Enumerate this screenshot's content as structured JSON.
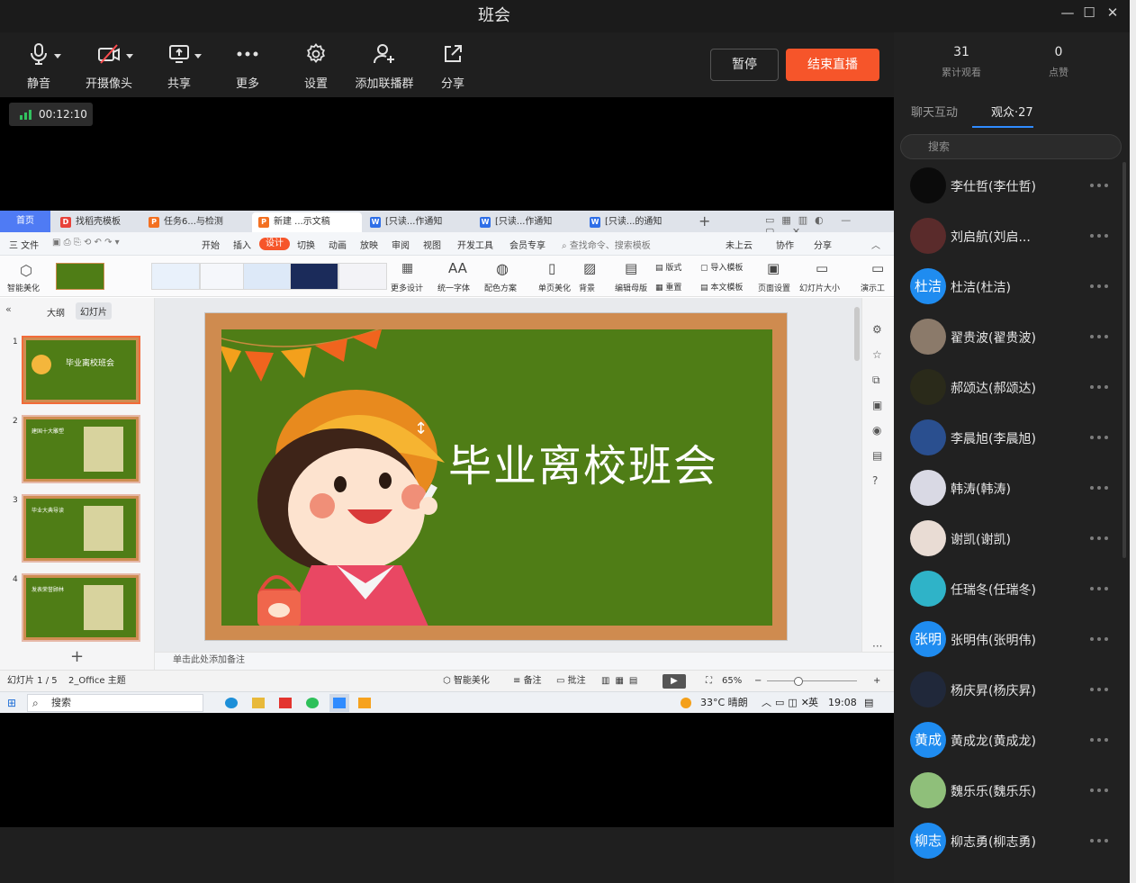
{
  "window": {
    "title": "班会"
  },
  "toolbar": {
    "mute_label": "静音",
    "camera_label": "开摄像头",
    "share_label": "共享",
    "more_label": "更多",
    "settings_label": "设置",
    "add_cohost_label": "添加联播群",
    "forward_label": "分享",
    "pause_label": "暂停",
    "end_label": "结束直播"
  },
  "live": {
    "elapsed": "00:12:10"
  },
  "wps": {
    "home_tab": "首页",
    "tabs": [
      "找稻壳模板",
      "任务6...与检测",
      "新建 ...示文稿",
      "[只读...作通知",
      "[只读...作通知",
      "[只读...的通知"
    ],
    "menu": [
      "三 文件",
      "开始",
      "插入",
      "设计",
      "切换",
      "动画",
      "放映",
      "审阅",
      "视图",
      "开发工具",
      "会员专享"
    ],
    "menu_search": "查找命令、搜索模板",
    "menu_right": [
      "未上云",
      "协作",
      "分享"
    ],
    "ribbon": {
      "smart_beautify": "智能美化",
      "more_design": "更多设计",
      "unify_fonts": "统一字体",
      "color_scheme": "配色方案",
      "single_page_beautify": "单页美化",
      "background": "背景",
      "edit_master": "编辑母版",
      "layout": "版式",
      "rearrange": "重置",
      "import_template": "导入模板",
      "text_template": "本文模板",
      "page_setup": "页面设置",
      "slide_size": "幻灯片大小",
      "present": "演示工"
    },
    "panel_tabs": [
      "大纲",
      "幻灯片"
    ],
    "slide_thumbs": [
      {
        "num": "1",
        "title": "毕业离校班会"
      },
      {
        "num": "2",
        "title": "建国十大雕塑"
      },
      {
        "num": "3",
        "title": "毕业大典导读"
      },
      {
        "num": "4",
        "title": "发表荣誉顾林"
      }
    ],
    "slide_title": "毕业离校班会",
    "notes_placeholder": "单击此处添加备注",
    "status": {
      "slide_counter": "幻灯片 1 / 5",
      "theme": "2_Office 主题",
      "smart_beautify": "智能美化",
      "notes": "备注",
      "comments": "批注",
      "zoom": "65%"
    }
  },
  "taskbar": {
    "search_placeholder": "搜索",
    "weather": "33°C  晴朗",
    "ime": "英",
    "time": "19:08"
  },
  "sidebar": {
    "stats": [
      {
        "value": "31",
        "label": "累计观看"
      },
      {
        "value": "0",
        "label": "点赞"
      }
    ],
    "tabs": [
      "聊天互动",
      "观众·27"
    ],
    "search_placeholder": "搜索",
    "audience": [
      {
        "name": "李仕哲(李仕哲)",
        "avatar_text": "",
        "avatar_color": "#0b0b0b"
      },
      {
        "name": "刘启航(刘启...",
        "avatar_text": "",
        "avatar_color": "#5a2b2b"
      },
      {
        "name": "杜洁(杜洁)",
        "avatar_text": "杜洁",
        "avatar_color": "#1f8cf0"
      },
      {
        "name": "翟贵波(翟贵波)",
        "avatar_text": "",
        "avatar_color": "#8b7a6a"
      },
      {
        "name": "郝颂达(郝颂达)",
        "avatar_text": "",
        "avatar_color": "#2a2a1a"
      },
      {
        "name": "李晨旭(李晨旭)",
        "avatar_text": "",
        "avatar_color": "#2a4f8f"
      },
      {
        "name": "韩涛(韩涛)",
        "avatar_text": "",
        "avatar_color": "#d9d9e4"
      },
      {
        "name": "谢凯(谢凯)",
        "avatar_text": "",
        "avatar_color": "#e9dcd4"
      },
      {
        "name": "任瑞冬(任瑞冬)",
        "avatar_text": "",
        "avatar_color": "#2fb3c8"
      },
      {
        "name": "张明伟(张明伟)",
        "avatar_text": "张明",
        "avatar_color": "#1f8cf0"
      },
      {
        "name": "杨庆昇(杨庆昇)",
        "avatar_text": "",
        "avatar_color": "#20283a"
      },
      {
        "name": "黄成龙(黄成龙)",
        "avatar_text": "黄成",
        "avatar_color": "#1f8cf0"
      },
      {
        "name": "魏乐乐(魏乐乐)",
        "avatar_text": "",
        "avatar_color": "#8fbf7a"
      },
      {
        "name": "柳志勇(柳志勇)",
        "avatar_text": "柳志",
        "avatar_color": "#1f8cf0"
      }
    ]
  },
  "colors": {
    "accent": "#f6552a",
    "link_blue": "#2f8bff",
    "board_green": "#4f7d16",
    "frame_brown": "#cf8b4f"
  }
}
